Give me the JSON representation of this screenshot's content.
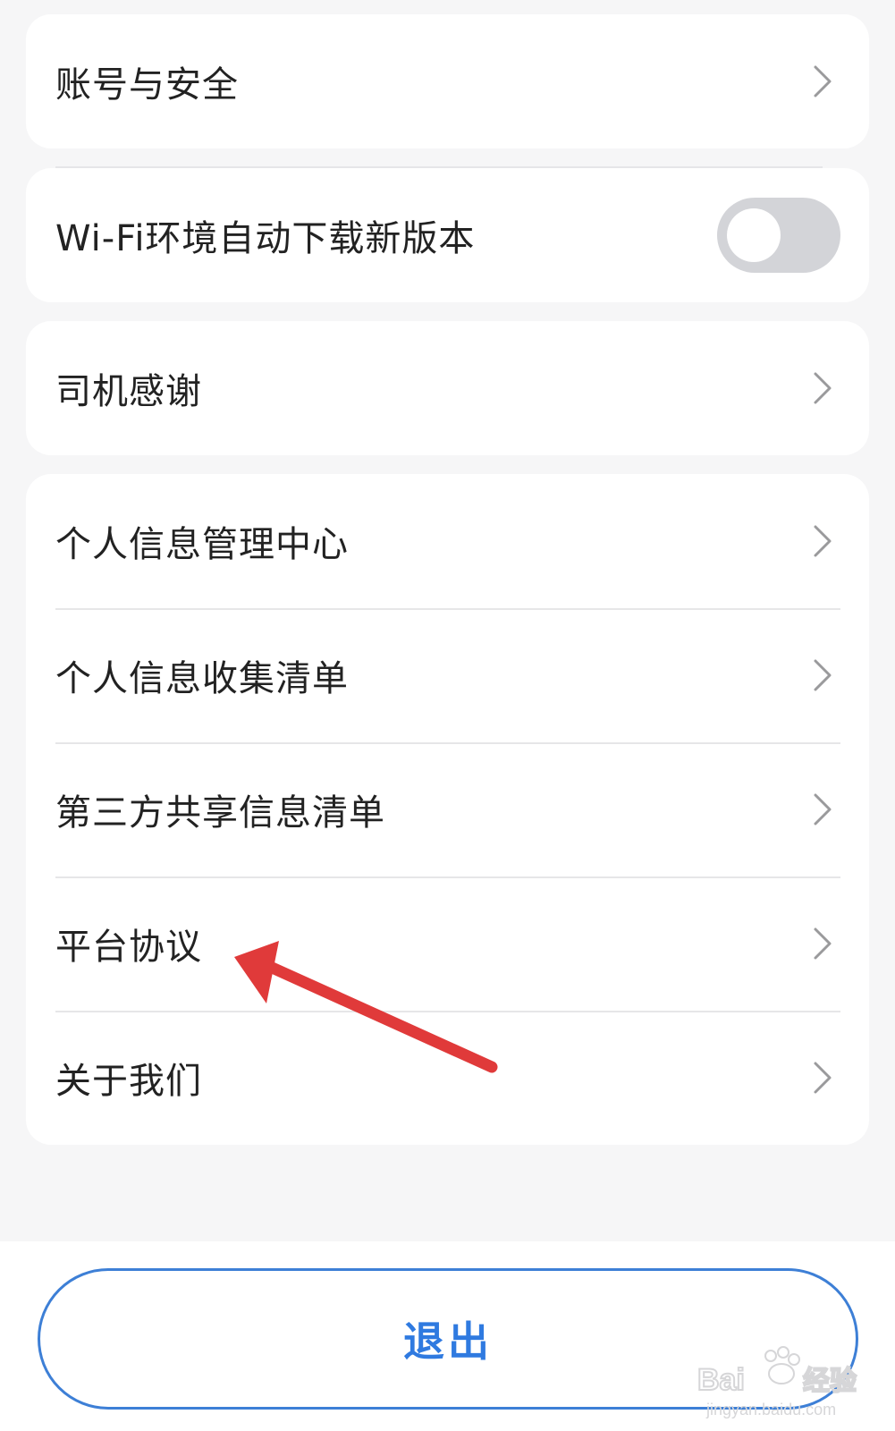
{
  "groups": {
    "account": {
      "label": "账号与安全"
    },
    "wifi_update": {
      "label": "Wi-Fi环境自动下载新版本",
      "toggle_on": false
    },
    "driver_thanks": {
      "label": "司机感谢"
    },
    "privacy": {
      "items": [
        {
          "label": "个人信息管理中心"
        },
        {
          "label": "个人信息收集清单"
        },
        {
          "label": "第三方共享信息清单"
        },
        {
          "label": "平台协议"
        },
        {
          "label": "关于我们"
        }
      ]
    }
  },
  "footer": {
    "logout_label": "退出"
  },
  "annotation": {
    "arrow_color": "#e03a3a",
    "points_to": "平台协议"
  },
  "watermark": {
    "brand": "Bai",
    "brand_suffix": "经验",
    "url": "jingyan.baidu.com"
  },
  "colors": {
    "accent": "#2f7ae0",
    "toggle_off": "#d3d4d8",
    "background": "#f6f6f7",
    "card": "#ffffff"
  }
}
